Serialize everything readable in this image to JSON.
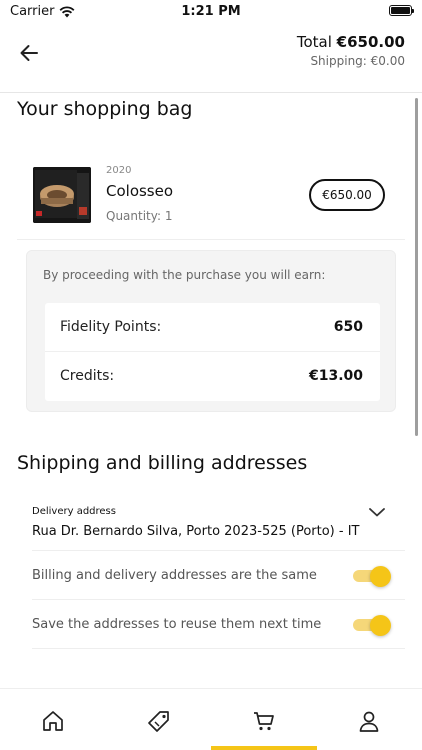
{
  "status_bar": {
    "carrier": "Carrier",
    "time": "1:21 PM",
    "battery_level": 1.0
  },
  "header": {
    "back_icon": "arrow-left-icon",
    "total_label": "Total ",
    "total_value": "€650.00",
    "shipping_text": "Shipping: €0.00"
  },
  "bag": {
    "title": "Your shopping bag",
    "items": [
      {
        "year": "2020",
        "name": "Colosseo",
        "quantity": "Quantity: 1",
        "price": "€650.00"
      }
    ]
  },
  "earn": {
    "intro": "By proceeding with the purchase you will earn:",
    "rows": [
      {
        "label": "Fidelity Points:",
        "value": "650"
      },
      {
        "label": "Credits:",
        "value": "€13.00"
      }
    ]
  },
  "addresses": {
    "title": "Shipping and billing addresses",
    "delivery_caption": "Delivery address",
    "delivery_value": "Rua Dr. Bernardo Silva, Porto 2023-525 (Porto) - IT",
    "toggles": [
      {
        "label": "Billing and delivery addresses are the same",
        "on": true
      },
      {
        "label": "Save the addresses to reuse them next time",
        "on": true
      }
    ]
  },
  "tabs": [
    {
      "name": "home",
      "icon": "home-icon"
    },
    {
      "name": "offers",
      "icon": "tag-icon"
    },
    {
      "name": "cart",
      "icon": "cart-icon",
      "active": true
    },
    {
      "name": "profile",
      "icon": "user-icon"
    }
  ],
  "colors": {
    "accent": "#f5c518",
    "text": "#111111",
    "muted": "#666666",
    "card_bg": "#f4f4f4"
  }
}
